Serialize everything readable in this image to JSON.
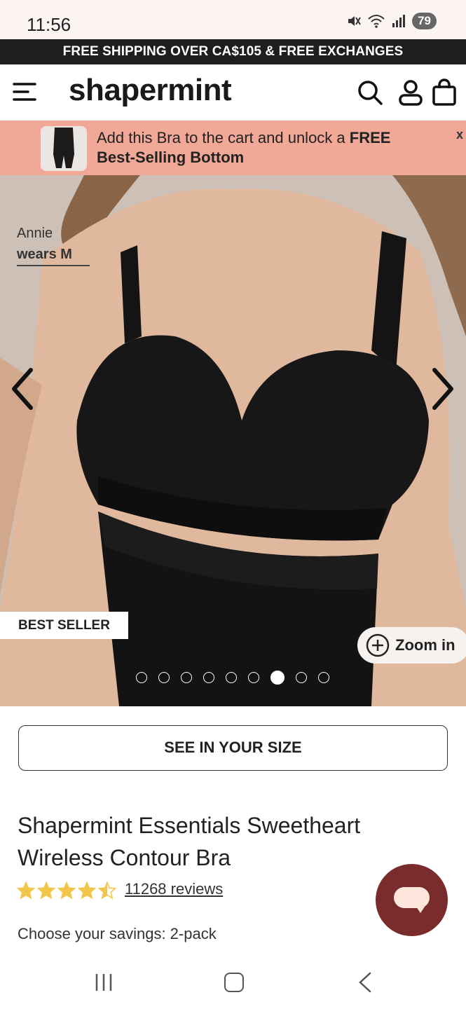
{
  "status_bar": {
    "time": "11:56",
    "battery": "79"
  },
  "promo_bar": {
    "text": "FREE SHIPPING OVER CA$105 & FREE EXCHANGES"
  },
  "header": {
    "logo": "shapermint"
  },
  "upsell": {
    "text_regular": "Add this Bra to the cart and unlock a ",
    "text_bold_1": "FREE",
    "text_bold_2": "Best-Selling Bottom",
    "close": "x"
  },
  "gallery": {
    "model_name": "Annie",
    "model_size": "wears M",
    "badge": "BEST SELLER",
    "zoom_label": "Zoom in",
    "slide_count": 9,
    "active_slide": 7
  },
  "see_size_button": "SEE IN YOUR SIZE",
  "product": {
    "title": "Shapermint Essentials Sweetheart Wireless Contour Bra",
    "rating": 4.5,
    "reviews": "11268 reviews",
    "savings_label": "Choose your savings: 2-pack"
  },
  "colors": {
    "accent_upsell": "#f2a896",
    "chat_button": "#7a2b2b",
    "star": "#f2c64a"
  }
}
